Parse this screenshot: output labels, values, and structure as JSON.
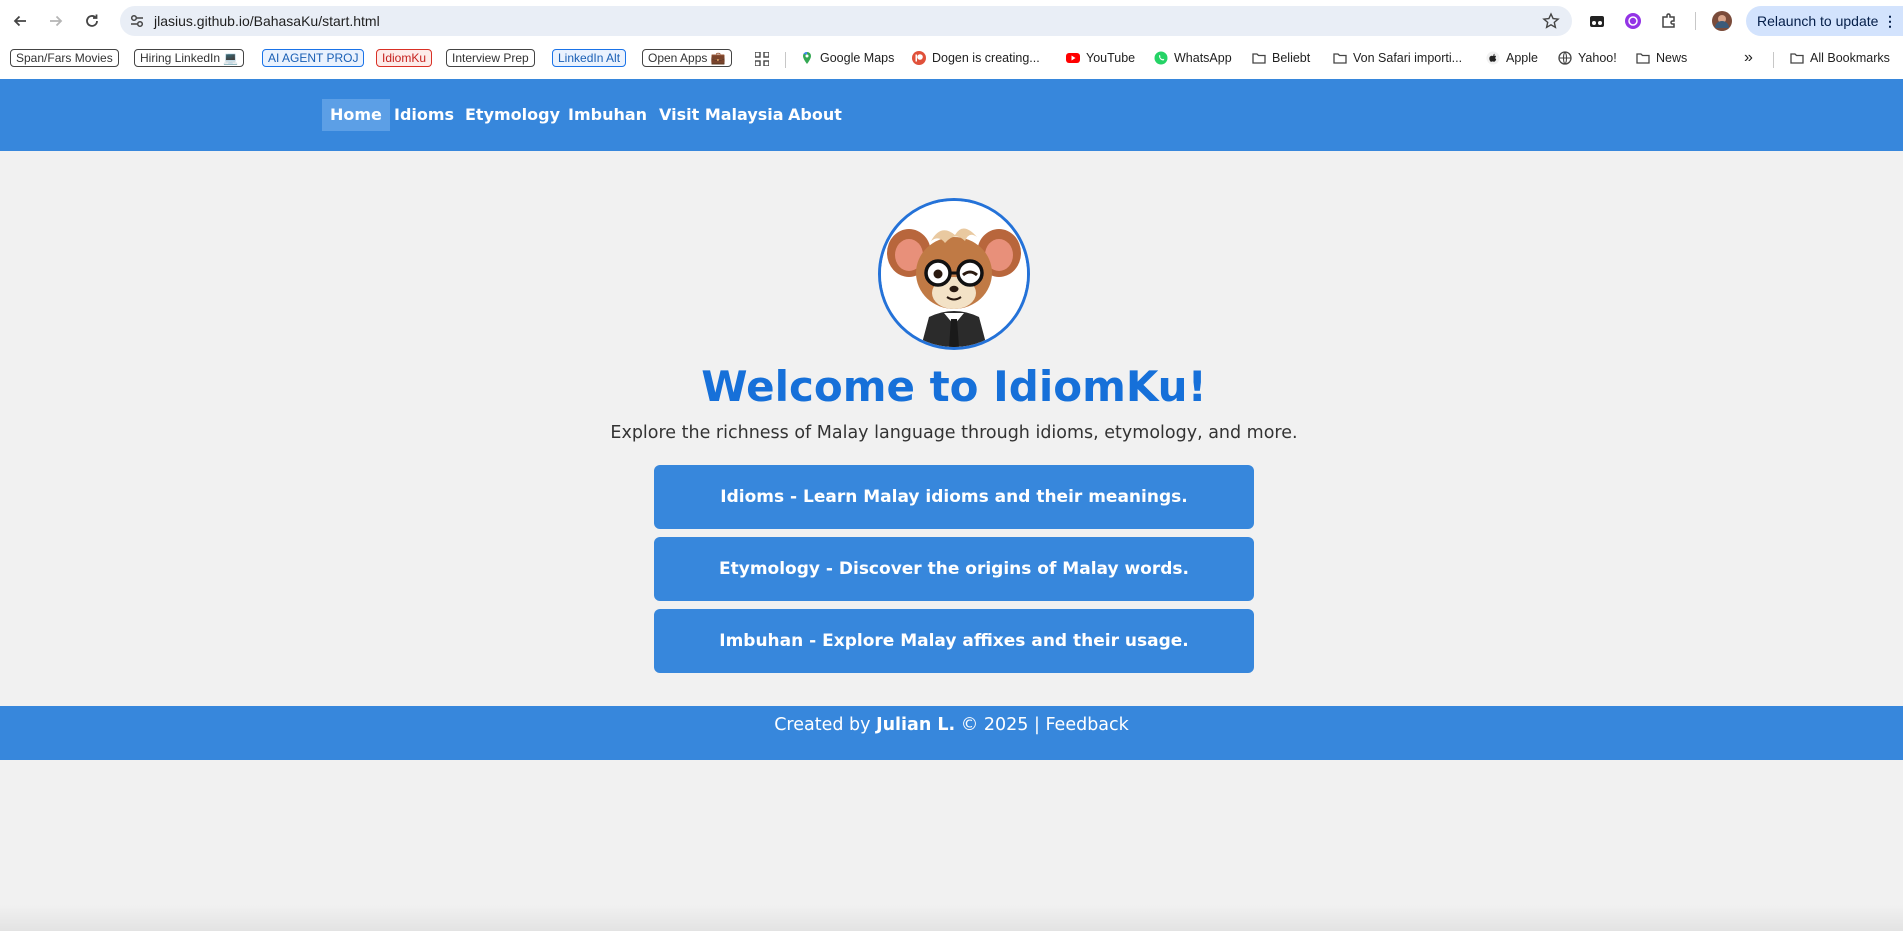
{
  "browser": {
    "url": "jlasius.github.io/BahasaKu/start.html",
    "relaunch_label": "Relaunch to update",
    "menu_glyph": "⋮",
    "more_bookmarks_glyph": "»",
    "bookmarks_chips": [
      {
        "label": "Span/Fars Movies",
        "style": "plain"
      },
      {
        "label": "Hiring LinkedIn 💻",
        "style": "plain"
      },
      {
        "label": "AI AGENT PROJ",
        "style": "blue"
      },
      {
        "label": "IdiomKu",
        "style": "red"
      },
      {
        "label": "Interview Prep",
        "style": "plain"
      },
      {
        "label": "LinkedIn Alt",
        "style": "blue"
      },
      {
        "label": "Open Apps 💼",
        "style": "plain"
      }
    ],
    "bookmarks": [
      {
        "label": "Google Maps",
        "icon": "maps-icon"
      },
      {
        "label": "Dogen is creating...",
        "icon": "patreon-icon"
      },
      {
        "label": "YouTube",
        "icon": "youtube-icon"
      },
      {
        "label": "WhatsApp",
        "icon": "whatsapp-icon"
      },
      {
        "label": "Beliebt",
        "icon": "folder-icon"
      },
      {
        "label": "Von Safari importi...",
        "icon": "folder-icon"
      },
      {
        "label": "Apple",
        "icon": "apple-icon"
      },
      {
        "label": "Yahoo!",
        "icon": "globe-icon"
      },
      {
        "label": "News",
        "icon": "folder-icon"
      }
    ],
    "all_bookmarks_label": "All Bookmarks"
  },
  "site": {
    "nav": [
      "Home",
      "Idioms",
      "Etymology",
      "Imbuhan",
      "Visit Malaysia",
      "About"
    ],
    "active_nav": "Home",
    "welcome": "Welcome to IdiomKu!",
    "tagline": "Explore the richness of Malay language through idioms, etymology, and more.",
    "cards": [
      "Idioms - Learn Malay idioms and their meanings.",
      "Etymology - Discover the origins of Malay words.",
      "Imbuhan - Explore Malay affixes and their usage."
    ],
    "footer": {
      "prefix": "Created by",
      "author": "Julian L.",
      "copyright": "© 2025 |",
      "link": "Feedback"
    }
  },
  "colors": {
    "brand_blue": "#3787dc",
    "title_blue": "#1670d9",
    "page_bg": "#f1f1f1"
  }
}
